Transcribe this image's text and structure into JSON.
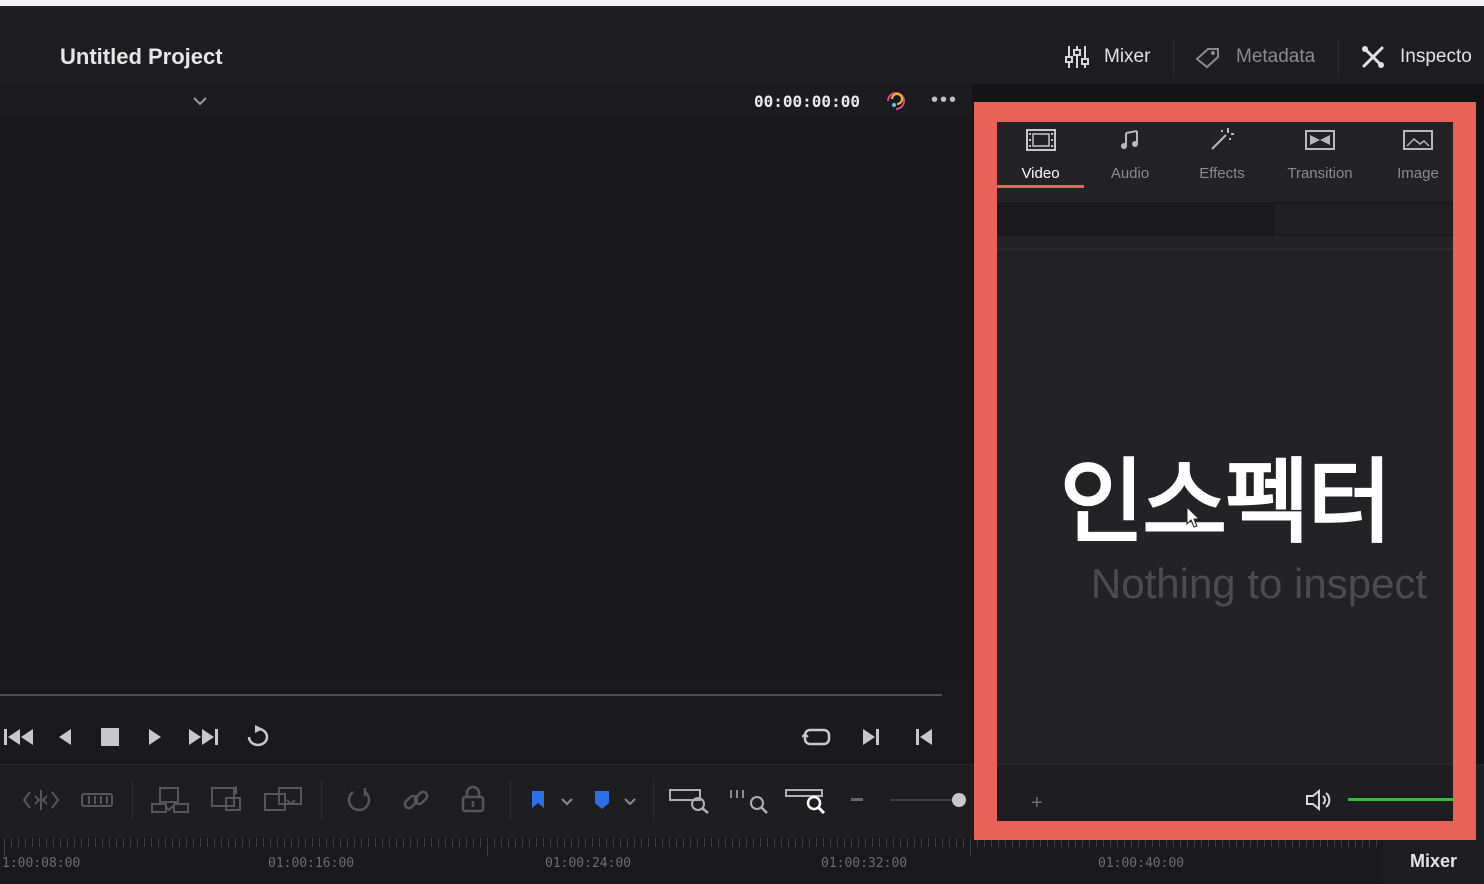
{
  "header": {
    "project_title": "Untitled Project",
    "mixer_label": "Mixer",
    "metadata_label": "Metadata",
    "inspector_label": "Inspecto"
  },
  "viewer": {
    "timecode": "00:00:00:00"
  },
  "inspector": {
    "tabs": [
      {
        "label": "Video",
        "icon": "film-icon",
        "active": true
      },
      {
        "label": "Audio",
        "icon": "music-note-icon",
        "active": false
      },
      {
        "label": "Effects",
        "icon": "magic-wand-icon",
        "active": false
      },
      {
        "label": "Transition",
        "icon": "transition-icon",
        "active": false
      },
      {
        "label": "Image",
        "icon": "image-icon",
        "active": false
      }
    ],
    "overlay_text": "인스펙터",
    "empty_text": "Nothing to inspect"
  },
  "timeline": {
    "ruler_labels": [
      "1:00:08:00",
      "01:00:16:00",
      "01:00:24:00",
      "01:00:32:00",
      "01:00:40:00"
    ]
  },
  "bottom": {
    "mixer_label": "Mixer"
  },
  "colors": {
    "highlight_frame": "#e8625a",
    "active_tab_underline": "#e8625a",
    "flag_blue": "#2f6fe6",
    "volume_green": "#2fbf3a"
  }
}
